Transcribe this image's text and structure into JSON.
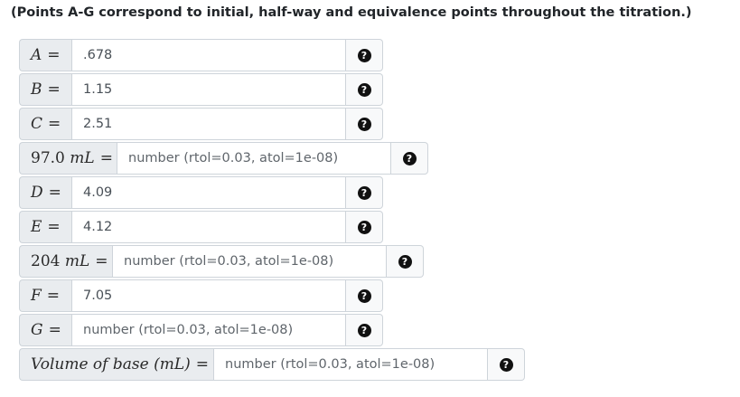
{
  "heading": "(Points A-G correspond to initial, half-way and equivalence points throughout the titration.)",
  "rows": [
    {
      "label_main": "A",
      "label_eq": "=",
      "value": ".678",
      "help_icon": "question-circle-icon"
    },
    {
      "label_main": "B",
      "label_eq": "=",
      "value": "1.15",
      "help_icon": "question-circle-icon"
    },
    {
      "label_main": "C",
      "label_eq": "=",
      "value": "2.51",
      "help_icon": "question-circle-icon"
    },
    {
      "label_num": "97.0",
      "label_unit": "mL",
      "label_eq": "=",
      "placeholder": "number (rtol=0.03, atol=1e-08)",
      "help_icon": "question-circle-icon"
    },
    {
      "label_main": "D",
      "label_eq": "=",
      "value": "4.09",
      "help_icon": "question-circle-icon"
    },
    {
      "label_main": "E",
      "label_eq": "=",
      "value": "4.12",
      "help_icon": "question-circle-icon"
    },
    {
      "label_num": "204",
      "label_unit": "mL",
      "label_eq": "=",
      "placeholder": "number (rtol=0.03, atol=1e-08)",
      "help_icon": "question-circle-icon"
    },
    {
      "label_main": "F",
      "label_eq": "=",
      "value": "7.05",
      "help_icon": "question-circle-icon"
    },
    {
      "label_main": "G",
      "label_eq": "=",
      "placeholder": "number (rtol=0.03, atol=1e-08)",
      "help_icon": "question-circle-icon"
    },
    {
      "label_text": "Volume of base",
      "label_unit": "(mL)",
      "label_eq": "=",
      "placeholder": "number (rtol=0.03, atol=1e-08)",
      "help_icon": "question-circle-icon"
    }
  ],
  "help_glyph": "?"
}
